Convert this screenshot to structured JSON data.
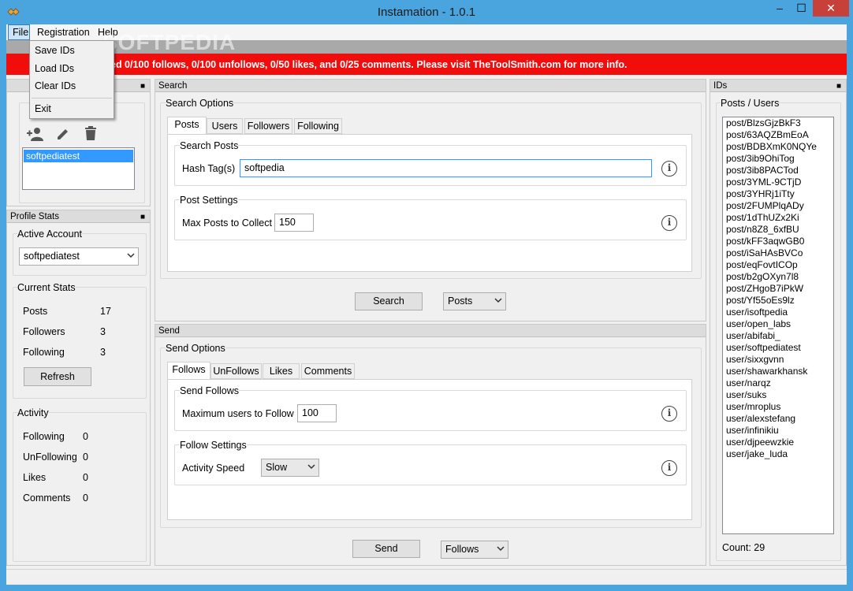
{
  "window": {
    "title": "Instamation - 1.0.1",
    "min_glyph": "–",
    "max_glyph": "☐",
    "close_glyph": "✕"
  },
  "menu": {
    "file": "File",
    "registration": "Registration",
    "help": "Help"
  },
  "file_menu": {
    "save_ids": "Save IDs",
    "load_ids": "Load IDs",
    "clear_ids": "Clear IDs",
    "exit": "Exit"
  },
  "watermark": "SOFTPEDIA",
  "trial_banner": "ed 0/100 follows, 0/100 unfollows, 0/50 likes, and 0/25 comments. Please visit TheToolSmith.com for more info.",
  "accounts": {
    "items": [
      "softpediatest"
    ]
  },
  "profile_stats": {
    "header": "Profile Stats",
    "active_account_label": "Active Account",
    "active_account_value": "softpediatest",
    "current_stats_label": "Current Stats",
    "posts_label": "Posts",
    "posts_value": "17",
    "followers_label": "Followers",
    "followers_value": "3",
    "following_label": "Following",
    "following_value": "3",
    "refresh_label": "Refresh",
    "activity_label": "Activity",
    "act_following_label": "Following",
    "act_following_value": "0",
    "act_unfollowing_label": "UnFollowing",
    "act_unfollowing_value": "0",
    "act_likes_label": "Likes",
    "act_likes_value": "0",
    "act_comments_label": "Comments",
    "act_comments_value": "0"
  },
  "search": {
    "header": "Search",
    "options_label": "Search Options",
    "tabs": [
      "Posts",
      "Users",
      "Followers",
      "Following"
    ],
    "search_posts_label": "Search Posts",
    "hashtag_label": "Hash Tag(s)",
    "hashtag_value": "softpedia",
    "post_settings_label": "Post Settings",
    "max_posts_label": "Max Posts to Collect",
    "max_posts_value": "150",
    "search_button": "Search",
    "mode_value": "Posts"
  },
  "send": {
    "header": "Send",
    "options_label": "Send Options",
    "tabs": [
      "Follows",
      "UnFollows",
      "Likes",
      "Comments"
    ],
    "send_follows_label": "Send Follows",
    "max_users_label": "Maximum users to Follow",
    "max_users_value": "100",
    "follow_settings_label": "Follow Settings",
    "activity_speed_label": "Activity Speed",
    "activity_speed_value": "Slow",
    "send_button": "Send",
    "mode_value": "Follows"
  },
  "ids": {
    "header": "IDs",
    "group_label": "Posts / Users",
    "items": [
      "post/BlzsGjzBkF3",
      "post/63AQZBmEoA",
      "post/BDBXmK0NQYe",
      "post/3ib9OhiTog",
      "post/3ib8PACTod",
      "post/3YML-9CTjD",
      "post/3YHRj1iTty",
      "post/2FUMPlqADy",
      "post/1dThUZx2Ki",
      "post/n8Z8_6xfBU",
      "post/kFF3aqwGB0",
      "post/iSaHAsBVCo",
      "post/eqFovtICOp",
      "post/b2gOXyn7l8",
      "post/ZHgoB7iPkW",
      "post/Yf55oEs9lz",
      "user/isoftpedia",
      "user/open_labs",
      "user/abifabi_",
      "user/softpediatest",
      "user/sixxgvnn",
      "user/shawarkhansk",
      "user/narqz",
      "user/suks",
      "user/mroplus",
      "user/alexstefang",
      "user/infinikiu",
      "user/djpeewzkie",
      "user/jake_luda"
    ],
    "count_label": "Count: 29"
  },
  "icons": {
    "app": "app-logo-icon",
    "add_user": "add-user-icon",
    "edit": "pencil-icon",
    "delete": "trash-icon",
    "info": "info-icon",
    "pin": "pin-icon",
    "dropdown": "chevron-down-icon"
  },
  "colors": {
    "titlebar": "#4aa4dd",
    "banner": "#f20d0d",
    "selection": "#3399ff",
    "close": "#c7403a"
  }
}
